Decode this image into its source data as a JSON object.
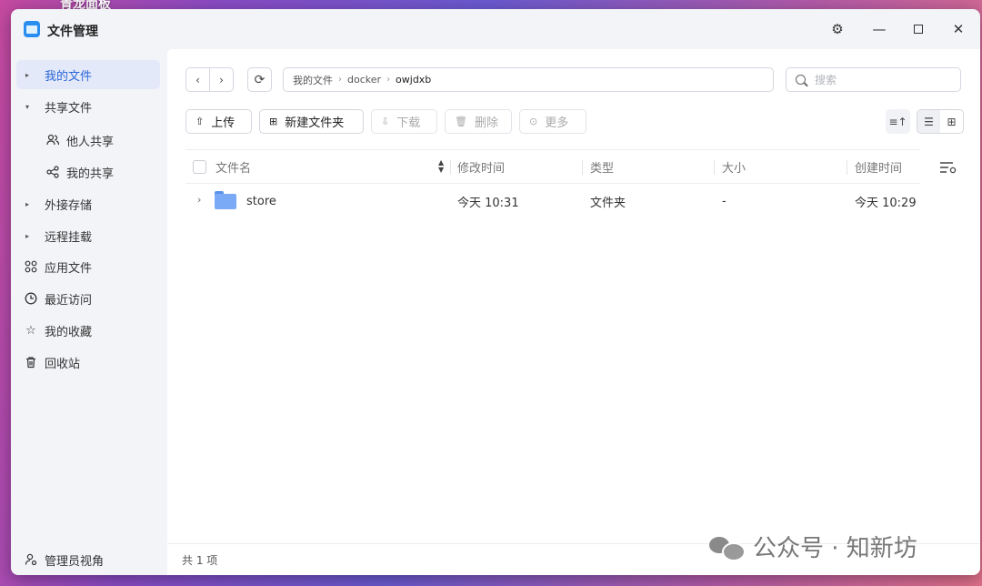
{
  "desktop": {
    "label": "青龙面板"
  },
  "window": {
    "title": "文件管理",
    "icons": {
      "settings": "gear-icon",
      "minimize": "minimize-icon",
      "maximize": "maximize-icon",
      "close": "close-icon"
    }
  },
  "sidebar": {
    "items": [
      {
        "label": "我的文件",
        "icon": "caret-right-icon",
        "active": true
      },
      {
        "label": "共享文件",
        "icon": "caret-down-icon"
      },
      {
        "label": "他人共享",
        "icon": "users-icon",
        "sub": true
      },
      {
        "label": "我的共享",
        "icon": "share-icon",
        "sub": true
      },
      {
        "label": "外接存储",
        "icon": "caret-right-icon"
      },
      {
        "label": "远程挂载",
        "icon": "caret-right-icon"
      },
      {
        "label": "应用文件",
        "icon": "apps-icon"
      },
      {
        "label": "最近访问",
        "icon": "clock-icon"
      },
      {
        "label": "我的收藏",
        "icon": "star-icon"
      },
      {
        "label": "回收站",
        "icon": "trash-icon"
      }
    ],
    "admin_view": "管理员视角"
  },
  "breadcrumb": {
    "items": [
      "我的文件",
      "docker",
      "owjdxb"
    ]
  },
  "search": {
    "placeholder": "搜索"
  },
  "toolbar": {
    "upload": "上传",
    "new_folder": "新建文件夹",
    "download": "下载",
    "delete": "删除",
    "more": "更多"
  },
  "table": {
    "columns": {
      "name": "文件名",
      "modified": "修改时间",
      "type": "类型",
      "size": "大小",
      "created": "创建时间"
    },
    "rows": [
      {
        "name": "store",
        "modified": "今天 10:31",
        "type": "文件夹",
        "size": "-",
        "created": "今天 10:29"
      }
    ]
  },
  "footer": {
    "count": "共 1 项"
  },
  "watermark": {
    "text": "公众号 · 知新坊"
  }
}
